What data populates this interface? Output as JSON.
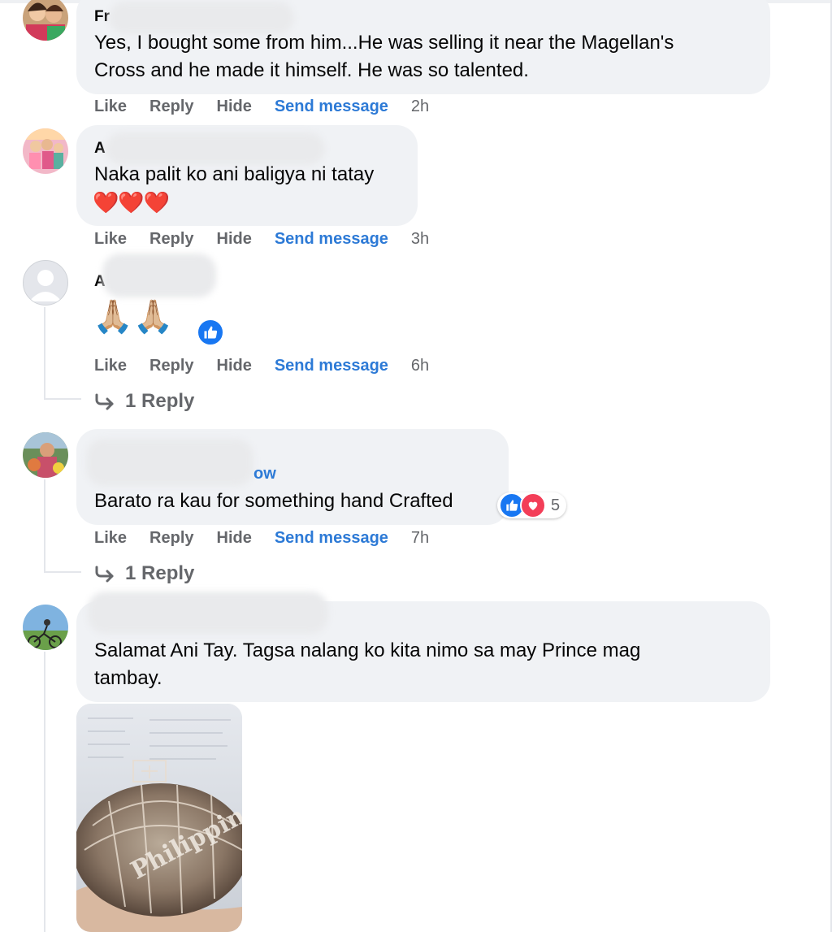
{
  "comments": [
    {
      "name_fragment": "Fr",
      "lines": [
        "Yes, I bought some from him...He was selling it near the Magellan's",
        "Cross and he made it himself. He was so talented."
      ],
      "time": "2h"
    },
    {
      "name_fragment": "A",
      "lines": [
        "Naka palit ko ani baligya ni tatay"
      ],
      "emoji": "❤️❤️❤️",
      "time": "3h"
    },
    {
      "name_fragment": "A",
      "emoji": "🙏🏼🙏🏼",
      "time": "6h",
      "replies_label": "1 Reply"
    },
    {
      "name_fragment": "",
      "link_fragment": "ow",
      "lines": [
        "Barato ra kau for something hand Crafted"
      ],
      "reaction_count": "5",
      "time": "7h",
      "replies_label": "1 Reply"
    },
    {
      "lines": [
        "Salamat Ani Tay. Tagsa nalang ko kita nimo sa may Prince mag",
        "tambay."
      ],
      "photo_text": "Philippines"
    }
  ],
  "actions": {
    "like": "Like",
    "reply": "Reply",
    "hide": "Hide",
    "send_message": "Send message"
  },
  "colors": {
    "bubble": "#f0f2f5",
    "link": "#2d7ad6",
    "meta": "#65676b",
    "like_blue": "#1877f2",
    "love_red": "#f33e58"
  }
}
